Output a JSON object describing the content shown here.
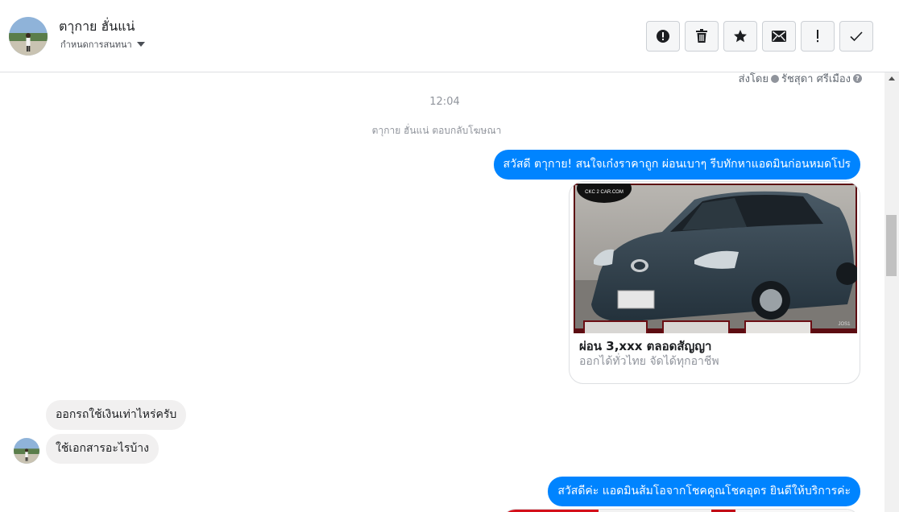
{
  "header": {
    "contact_name": "ตาุกาย ฮั่นแน่",
    "assign_label": "กำหนดการสนทนา",
    "actions": [
      "alert-icon",
      "trash-icon",
      "star-icon",
      "mail-icon",
      "exclamation-icon",
      "check-icon"
    ]
  },
  "conversation": {
    "sent_by_prefix": "ส่งโดย",
    "sent_by_name": "รัชสุดา ศรีเมือง",
    "timestamp": "12:04",
    "system_note": "ตาุกาย ฮั่นแน่ ตอบกลับโฆษณา",
    "messages": [
      {
        "direction": "out",
        "text": "สวัสดี ตาุกาย! สนใจเก๋งราคาถูก ผ่อนเบาๆ รีบทักหาแอดมินก่อนหมดโปร"
      },
      {
        "direction": "in",
        "text": "ออกรถใช้เงินเท่าไหร่ครับ"
      },
      {
        "direction": "in",
        "text": "ใช้เอกสารอะไรบ้าง"
      },
      {
        "direction": "out",
        "text": "สวัสดีค่ะ แอดมินส้มโอจากโชคคูณโชคอุดร ยินดีให้บริการค่ะ"
      }
    ],
    "card": {
      "logo_text": "CKC 2 CAR.COM",
      "plate_text": "JOS1",
      "title": "ผ่อน 3,xxx ตลอดสัญญา",
      "subtitle": "ออกได้ทั่วไทย จัดได้ทุกอาชีพ"
    }
  },
  "colors": {
    "accent": "#0084ff",
    "incoming_bubble": "#f1f0f0",
    "muted_text": "#90949c"
  }
}
